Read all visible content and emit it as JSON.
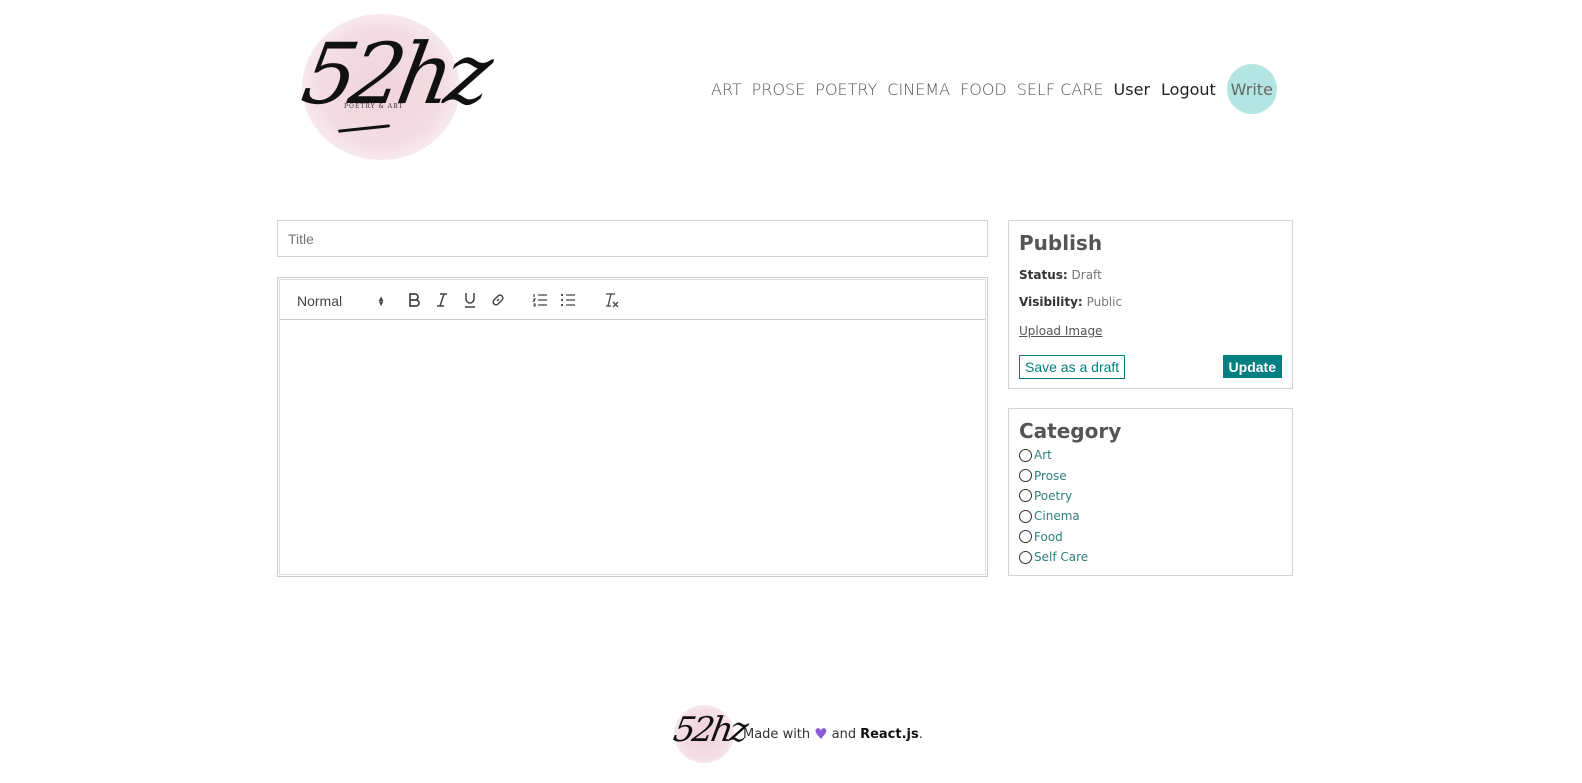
{
  "header": {
    "logo_text": "52hz",
    "logo_subtext": "POETRY & ART",
    "nav_categories": [
      "ART",
      "PROSE",
      "POETRY",
      "CINEMA",
      "FOOD",
      "SELF CARE"
    ],
    "nav_user": "User",
    "nav_logout": "Logout",
    "nav_write": "Write"
  },
  "editor": {
    "title_placeholder": "Title",
    "format_select": "Normal"
  },
  "publish": {
    "heading": "Publish",
    "status_label": "Status:",
    "status_value": "Draft",
    "visibility_label": "Visibility:",
    "visibility_value": "Public",
    "upload_label": "Upload Image",
    "save_draft_label": "Save as a draft",
    "update_label": "Update"
  },
  "category": {
    "heading": "Category",
    "options": [
      "Art",
      "Prose",
      "Poetry",
      "Cinema",
      "Food",
      "Self Care"
    ]
  },
  "footer": {
    "logo_text": "52hz",
    "made_with": "Made with",
    "and": "and",
    "react": "React.js",
    "period": "."
  },
  "colors": {
    "accent": "#008080",
    "write_bubble": "#b3e6e3",
    "heart": "#8a5bd8"
  }
}
